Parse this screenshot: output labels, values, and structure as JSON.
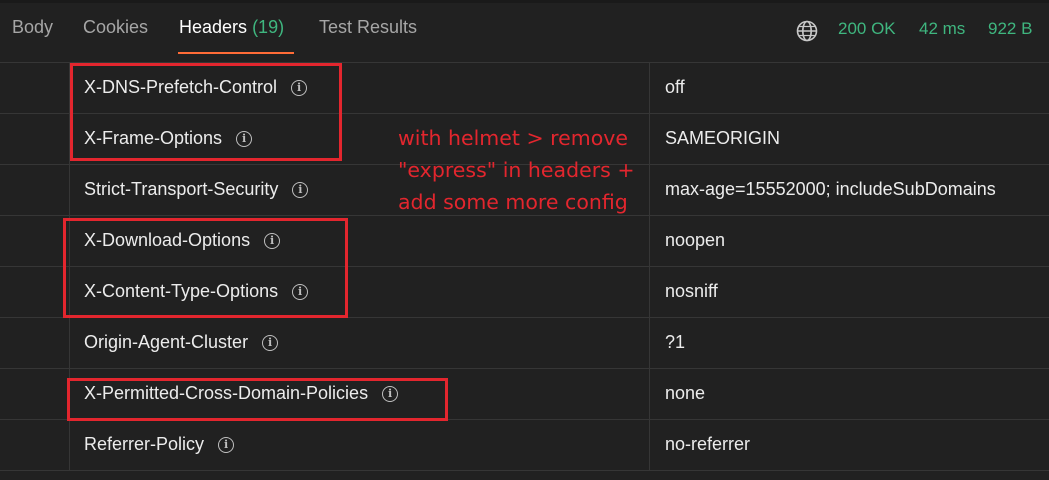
{
  "tabs": [
    {
      "label": "Body"
    },
    {
      "label": "Cookies"
    },
    {
      "label": "Headers",
      "count": "(19)"
    },
    {
      "label": "Test Results"
    }
  ],
  "status": {
    "globe_icon": "globe-icon",
    "code": "200 OK",
    "time": "42 ms",
    "size": "922 B",
    "color": "#3fb67f"
  },
  "headers": [
    {
      "key": "X-DNS-Prefetch-Control",
      "value": "off"
    },
    {
      "key": "X-Frame-Options",
      "value": "SAMEORIGIN"
    },
    {
      "key": "Strict-Transport-Security",
      "value": "max-age=15552000; includeSubDomains"
    },
    {
      "key": "X-Download-Options",
      "value": "noopen"
    },
    {
      "key": "X-Content-Type-Options",
      "value": "nosniff"
    },
    {
      "key": "Origin-Agent-Cluster",
      "value": "?1"
    },
    {
      "key": "X-Permitted-Cross-Domain-Policies",
      "value": "none"
    },
    {
      "key": "Referrer-Policy",
      "value": "no-referrer"
    }
  ],
  "annotation": {
    "lines": [
      "with helmet > remove",
      "\"express\" in headers +",
      "add some more config"
    ],
    "color": "#e3262e"
  },
  "accent_color": "#ff6c37"
}
